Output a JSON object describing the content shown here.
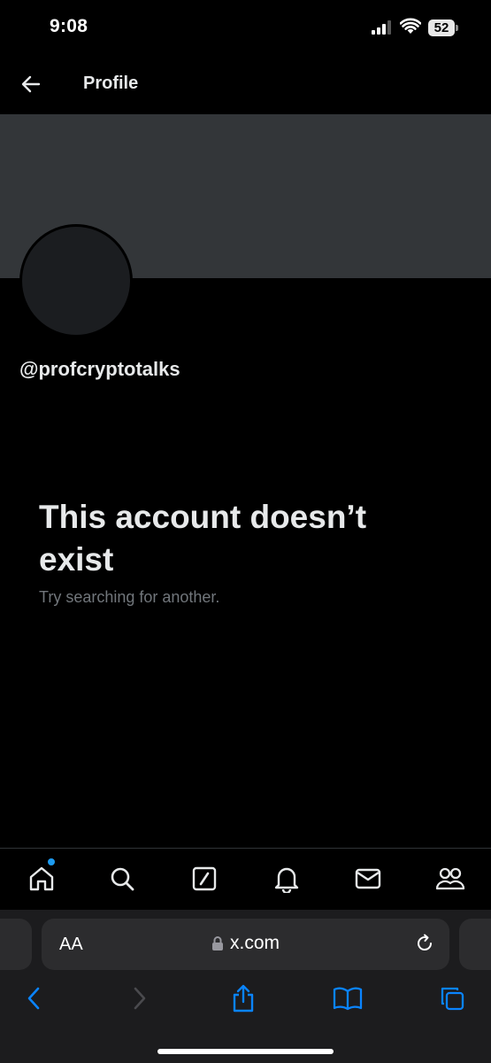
{
  "status_bar": {
    "time": "9:08",
    "battery": "52"
  },
  "header": {
    "title": "Profile"
  },
  "profile": {
    "handle": "@profcryptotalks"
  },
  "empty_state": {
    "title": "This account doesn’t exist",
    "subtitle": "Try searching for another."
  },
  "bottom_nav": {
    "items": [
      "home-icon",
      "search-icon",
      "grok-icon",
      "notifications-icon",
      "messages-icon",
      "communities-icon"
    ],
    "active": "home",
    "badge_color": "#1d9bf0"
  },
  "browser": {
    "text_size_label": "AA",
    "url": "x.com",
    "accent": "#0a84ff"
  },
  "colors": {
    "background": "#000000",
    "banner": "#333639",
    "muted_text": "#71767b"
  }
}
